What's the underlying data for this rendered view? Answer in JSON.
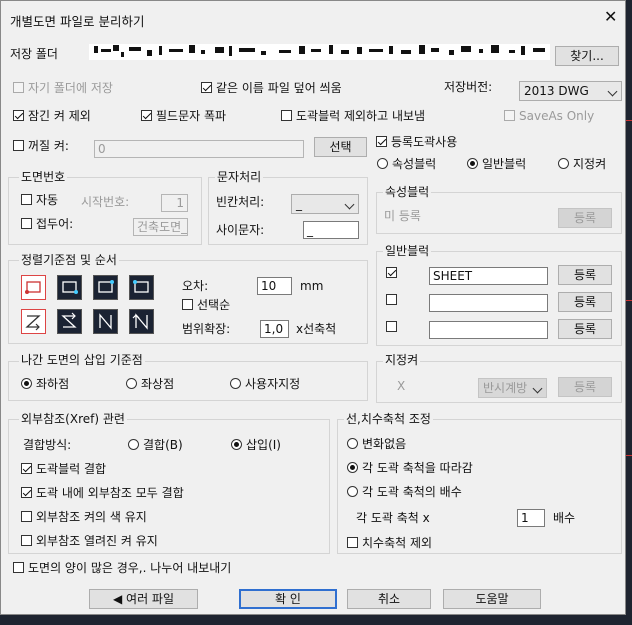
{
  "dialog": {
    "title": "개별도면 파일로 분리하기",
    "close_glyph": "✕",
    "save_folder_label": "저장 폴더",
    "browse_label": "찾기...",
    "own_folder_label": "자기 폴더에 저장",
    "overwrite_label": "같은 이름 파일 덮어 씌움",
    "save_version_label": "저장버전:",
    "save_version_value": "2013 DWG",
    "skip_locked_label": "잠긴 켜 제외",
    "explode_field_label": "필드문자 폭파",
    "exclude_block_label": "도곽블럭 제외하고 내보냄",
    "saveas_only_label": "SaveAs Only",
    "off_layer_label": "꺼질 켜:",
    "off_layer_value": "0",
    "select_label": "선택",
    "use_border_label": "등록도곽사용",
    "attr_block_label": "속성블럭",
    "normal_block_label": "일반블럭",
    "named_layer_label": "지정켜"
  },
  "sheet_number": {
    "title": "도면번호",
    "auto_label": "자동",
    "start_label": "시작번호:",
    "start_value": "1",
    "prefix_label": "접두어:",
    "prefix_value": "건축도면_"
  },
  "text_processing": {
    "title": "문자처리",
    "blank_label": "빈칸처리:",
    "blank_value": "_",
    "between_label": "사이문자:",
    "between_value": "_"
  },
  "attr_block": {
    "title": "속성블럭",
    "status": "미 등록",
    "register_label": "등록"
  },
  "sort": {
    "title": "정렬기준점 및 순서",
    "icons": [
      "sort-bottom-left-icon",
      "sort-bottom-right-icon",
      "sort-top-right-icon",
      "sort-top-left-icon",
      "order-z-icon",
      "order-reverse-z-icon",
      "order-n-icon",
      "order-reverse-n-icon"
    ],
    "tolerance_label": "오차:",
    "tolerance_value": "10",
    "tolerance_unit": "mm",
    "select_order_label": "선택순",
    "range_label": "범위확장:",
    "range_value": "1,0",
    "range_unit": "x선축척"
  },
  "normal_block": {
    "title": "일반블럭",
    "rows": [
      {
        "checked": true,
        "value": "SHEET",
        "button": "등록"
      },
      {
        "checked": false,
        "value": "",
        "button": "등록"
      },
      {
        "checked": false,
        "value": "",
        "button": "등록"
      }
    ]
  },
  "insert_point": {
    "title": "나간 도면의 삽입 기준점",
    "options": [
      "좌하점",
      "좌상점",
      "사용자지정"
    ],
    "selected": 0
  },
  "named_layer": {
    "title": "지정켜",
    "x_glyph": "X",
    "direction_value": "반시계방",
    "register_label": "등록"
  },
  "xref": {
    "title": "외부참조(Xref) 관련",
    "bind_method_label": "결합방식:",
    "bind_label": "결합(B)",
    "insert_label": "삽입(I)",
    "bind_border_label": "도곽블럭 결합",
    "bind_all_label": "도곽 내에 외부참조 모두 결합",
    "keep_color_label": "외부참조 켜의 색 유지",
    "keep_open_label": "외부참조 열려진 켜 유지"
  },
  "scale": {
    "title": "선,치수축척 조정",
    "no_change_label": "변화없음",
    "follow_label": "각 도곽 축척을 따라감",
    "multiple_label": "각 도곽 축척의 배수",
    "factor_label": "각 도곽 축척 x",
    "factor_value": "1",
    "factor_unit": "배수",
    "exclude_dim_label": "치수축척 제외"
  },
  "split_export_label": "도면의 양이 많은 경우,. 나누어 내보내기",
  "footer": {
    "multi_file_label": "◀ 여러 파일",
    "ok_label": "확 인",
    "cancel_label": "취소",
    "help_label": "도움말"
  },
  "colors": {
    "dialog_bg": "#f0f0f0",
    "desktop_bg": "#1e2430",
    "default_button_border": "#2f6fd0"
  }
}
